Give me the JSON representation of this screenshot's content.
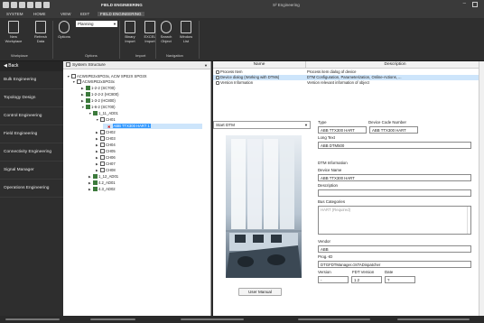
{
  "titlebar": {
    "context_tab": "FIELD ENGINEERING",
    "window_title": "S² Engineering"
  },
  "menu": {
    "tabs": [
      "SYSTEM",
      "HOME",
      "VIEW",
      "EDIT",
      "FIELD ENGINEERING"
    ]
  },
  "ribbon": {
    "new_workplace": "New\nWorkplace",
    "refresh_data": "Refresh\nData",
    "options": "Options",
    "planning_value": "Planning",
    "binary_import": "Binary\nImport",
    "excel_import": "EXCEL\nImport",
    "search_object": "Search\nObject",
    "window_list": "Window\nList",
    "groups": {
      "workplace": "Workplace",
      "options": "Options",
      "import": "Import",
      "navigation": "Navigation"
    }
  },
  "leftnav": {
    "back": "Back",
    "items": [
      "Bulk Engineering",
      "Topology Design",
      "Control Engineering",
      "Field Engineering",
      "Connectivity Engineering",
      "Signal Manager",
      "Operations Engineering"
    ]
  },
  "tree": {
    "header": "System Structure",
    "rows": [
      "ACWSPE2xSPO3x, ACW SPE2X SPO3X",
      "ACWSPE2xSPO3x",
      "1-2-2 (SC700)",
      "1-2-2-2 (HC800)",
      "1-3-2 (HC800)",
      "1-6-2 (SC700)",
      "1_11_AD01",
      "CH01",
      "ABB TTX300 HART 1",
      "CH02",
      "CH03",
      "CH04",
      "CH05",
      "CH06",
      "CH07",
      "CH08",
      "1_12_AD01",
      "4.2_AD01",
      "4.3_AD02"
    ]
  },
  "functions": {
    "header_name": "Name",
    "header_description": "Description",
    "rows": [
      {
        "name": "Process Item",
        "description": "Process item dialog of device"
      },
      {
        "name": "Device dialog (Working with DTMs)",
        "description": "DTM Configuration, Parameterization, Online-Actions, ..."
      },
      {
        "name": "Version Information",
        "description": "Version relevant information of object"
      }
    ]
  },
  "dtm": {
    "selector": "Start DTM",
    "user_manual": "User Manual"
  },
  "props": {
    "type_label": "Type",
    "type_value": "ABB TTX300 HART",
    "device_code_label": "Device Code Number",
    "device_code_value": "ABB TTX300 HART",
    "long_text_label": "Long Text",
    "long_text_value": "ABB DTM500",
    "dtm_info_label": "DTM Information",
    "device_name_label": "Device Name",
    "device_name_value": "ABB TTX300 HART",
    "description_label": "Description",
    "description_value": "",
    "bus_categories_label": "Bus Categories",
    "bus_categories_value": "HART (Required)",
    "vendor_label": "Vendor",
    "vendor_value": "ABB",
    "prog_id_label": "Prog.-ID",
    "prog_id_value": "DTGFDTManager.clsTADispatcher",
    "version_label": "Version",
    "version_value": "-",
    "fdt_version_label": "FDT Version",
    "fdt_version_value": "1.2",
    "date_label": "Date",
    "date_value": "?"
  }
}
